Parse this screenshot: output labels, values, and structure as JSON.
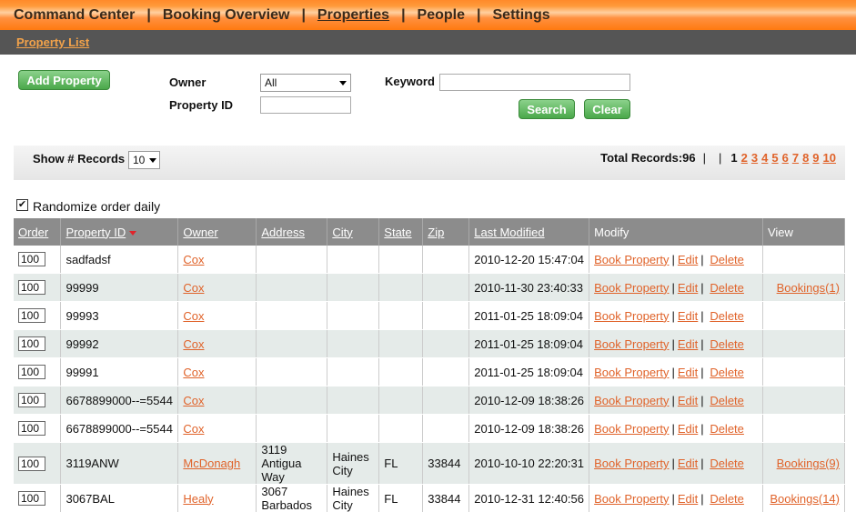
{
  "nav": {
    "items": [
      {
        "label": "Command Center"
      },
      {
        "label": "Booking Overview"
      },
      {
        "label": "Properties"
      },
      {
        "label": "People"
      },
      {
        "label": "Settings"
      }
    ],
    "sep": "|"
  },
  "subnav": {
    "label": "Property List"
  },
  "filters": {
    "add_button": "Add Property",
    "owner_label": "Owner",
    "owner_value": "All",
    "property_id_label": "Property ID",
    "property_id_value": "",
    "keyword_label": "Keyword",
    "keyword_value": "",
    "search_button": "Search",
    "clear_button": "Clear"
  },
  "records": {
    "show_label": "Show # Records",
    "show_value": "10",
    "total_label": "Total Records:96",
    "sep": "|",
    "current_page": "1",
    "pages": [
      "2",
      "3",
      "4",
      "5",
      "6",
      "7",
      "8",
      "9",
      "10"
    ]
  },
  "randomize": {
    "label": "Randomize order daily",
    "checked": true
  },
  "table": {
    "headers": {
      "order": "Order",
      "property_id": "Property ID",
      "owner": "Owner",
      "address": "Address",
      "city": "City",
      "state": "State",
      "zip": "Zip",
      "last_modified": "Last Modified",
      "modify": "Modify",
      "view": "View"
    },
    "actions": {
      "book": "Book Property",
      "edit": "Edit",
      "delete": "Delete",
      "sep": "|"
    },
    "rows": [
      {
        "order": "100",
        "property_id": "sadfadsf",
        "owner": "Cox",
        "address": "",
        "city": "",
        "state": "",
        "zip": "",
        "last_modified": "2010-12-20 15:47:04",
        "view": ""
      },
      {
        "order": "100",
        "property_id": "99999",
        "owner": "Cox",
        "address": "",
        "city": "",
        "state": "",
        "zip": "",
        "last_modified": "2010-11-30 23:40:33",
        "view": "Bookings(1)"
      },
      {
        "order": "100",
        "property_id": "99993",
        "owner": "Cox",
        "address": "",
        "city": "",
        "state": "",
        "zip": "",
        "last_modified": "2011-01-25 18:09:04",
        "view": ""
      },
      {
        "order": "100",
        "property_id": "99992",
        "owner": "Cox",
        "address": "",
        "city": "",
        "state": "",
        "zip": "",
        "last_modified": "2011-01-25 18:09:04",
        "view": ""
      },
      {
        "order": "100",
        "property_id": "99991",
        "owner": "Cox",
        "address": "",
        "city": "",
        "state": "",
        "zip": "",
        "last_modified": "2011-01-25 18:09:04",
        "view": ""
      },
      {
        "order": "100",
        "property_id": "6678899000--=5544",
        "owner": "Cox",
        "address": "",
        "city": "",
        "state": "",
        "zip": "",
        "last_modified": "2010-12-09 18:38:26",
        "view": ""
      },
      {
        "order": "100",
        "property_id": "6678899000--=5544",
        "owner": "Cox",
        "address": "",
        "city": "",
        "state": "",
        "zip": "",
        "last_modified": "2010-12-09 18:38:26",
        "view": ""
      },
      {
        "order": "100",
        "property_id": "3119ANW",
        "owner": "McDonagh",
        "address": "3119 Antigua Way",
        "city": "Haines City",
        "state": "FL",
        "zip": "33844",
        "last_modified": "2010-10-10 22:20:31",
        "view": "Bookings(9)"
      },
      {
        "order": "100",
        "property_id": "3067BAL",
        "owner": "Healy",
        "address": "3067 Barbados",
        "city": "Haines City",
        "state": "FL",
        "zip": "33844",
        "last_modified": "2010-12-31 12:40:56",
        "view": "Bookings(14)"
      }
    ]
  }
}
